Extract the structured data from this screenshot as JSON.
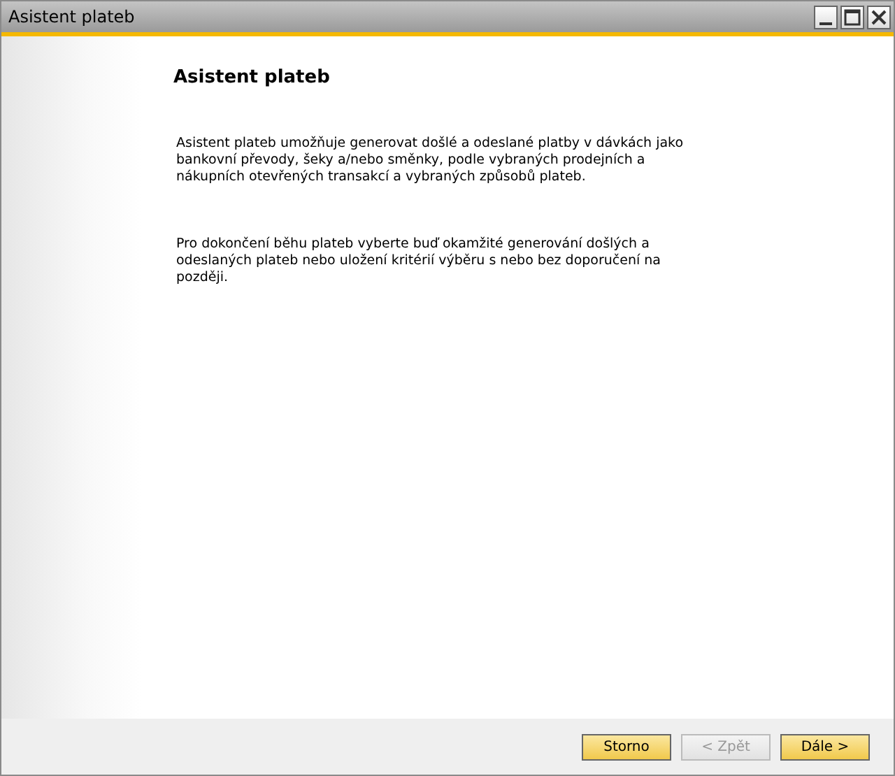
{
  "window": {
    "title": "Asistent plateb"
  },
  "page": {
    "heading": "Asistent plateb",
    "paragraphs": [
      "Asistent plateb umožňuje generovat došlé a odeslané platby v dávkách jako bankovní převody, šeky a/nebo směnky, podle vybraných prodejních a nákupních otevřených transakcí a vybraných způsobů plateb.",
      "Pro dokončení běhu plateb vyberte buď okamžité generování došlých a odeslaných plateb nebo uložení kritérií výběru s nebo bez doporučení na později."
    ]
  },
  "buttons": [
    {
      "label": "Storno",
      "disabled": false
    },
    {
      "label": "< Zpět",
      "disabled": true
    },
    {
      "label": "Dále >",
      "disabled": false
    }
  ]
}
